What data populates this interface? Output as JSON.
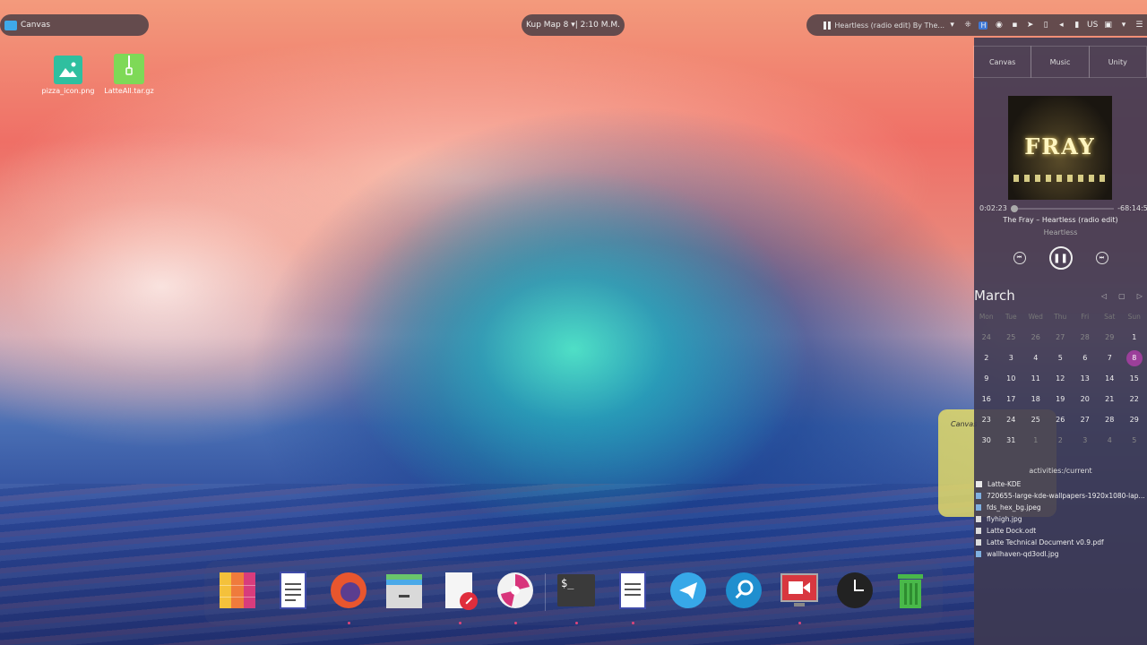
{
  "window_pill": {
    "title": "Canvas"
  },
  "clock": {
    "text": "Kup Map 8 ▾| 2:10 M.M."
  },
  "tray": {
    "media_text": "Heartless (radio edit) By The...",
    "icons": [
      "pause-icon",
      "chevron-down-icon",
      "network-icon",
      "app-icon",
      "record-icon",
      "video-icon",
      "send-icon",
      "clipboard-icon",
      "volume-icon",
      "battery-icon",
      "keyboard-layout",
      "display-icon",
      "chevron-down-icon",
      "menu-icon"
    ],
    "keyboard_layout": "US"
  },
  "desktop_icons": [
    {
      "label": "pizza_icon.png",
      "color": "#2fbf9f"
    },
    {
      "label": "LatteAll.tar.gz",
      "color": "#7ed957"
    }
  ],
  "panel": {
    "tabs": [
      "Canvas",
      "Music",
      "Unity"
    ],
    "media": {
      "band_art": "FRAY",
      "elapsed": "0:02:23",
      "remaining": "-68:14:51",
      "progress": 0.001,
      "track": "The Fray – Heartless (radio edit)",
      "album": "Heartless"
    },
    "calendar": {
      "month": "March",
      "weekdays": [
        "Mon",
        "Tue",
        "Wed",
        "Thu",
        "Fri",
        "Sat",
        "Sun"
      ],
      "days": [
        {
          "d": "24",
          "dim": true
        },
        {
          "d": "25",
          "dim": true
        },
        {
          "d": "26",
          "dim": true
        },
        {
          "d": "27",
          "dim": true
        },
        {
          "d": "28",
          "dim": true
        },
        {
          "d": "29",
          "dim": true
        },
        {
          "d": "1"
        },
        {
          "d": "2"
        },
        {
          "d": "3"
        },
        {
          "d": "4"
        },
        {
          "d": "5"
        },
        {
          "d": "6"
        },
        {
          "d": "7"
        },
        {
          "d": "8",
          "today": true
        },
        {
          "d": "9"
        },
        {
          "d": "10"
        },
        {
          "d": "11"
        },
        {
          "d": "12"
        },
        {
          "d": "13"
        },
        {
          "d": "14"
        },
        {
          "d": "15"
        },
        {
          "d": "16"
        },
        {
          "d": "17"
        },
        {
          "d": "18"
        },
        {
          "d": "19"
        },
        {
          "d": "20"
        },
        {
          "d": "21"
        },
        {
          "d": "22"
        },
        {
          "d": "23"
        },
        {
          "d": "24"
        },
        {
          "d": "25"
        },
        {
          "d": "26"
        },
        {
          "d": "27"
        },
        {
          "d": "28"
        },
        {
          "d": "29"
        },
        {
          "d": "30"
        },
        {
          "d": "31"
        },
        {
          "d": "1",
          "dim": true
        },
        {
          "d": "2",
          "dim": true
        },
        {
          "d": "3",
          "dim": true
        },
        {
          "d": "4",
          "dim": true
        },
        {
          "d": "5",
          "dim": true
        }
      ]
    },
    "folder": {
      "title": "activities:/current",
      "files": [
        "Latte-KDE",
        "720655-large-kde-wallpapers-1920x1080-lap...",
        "fds_hex_bg.jpeg",
        "flyhigh.jpg",
        "Latte Dock.odt",
        "Latte Technical Document v0.9.pdf",
        "wallhaven-qd3odl.jpg"
      ]
    }
  },
  "note": {
    "title": "Canvas"
  },
  "dock": {
    "items": [
      {
        "name": "color-palette-app",
        "color": "#f0a030",
        "dot": false
      },
      {
        "name": "text-document",
        "color": "#ffffff",
        "dot": false
      },
      {
        "name": "firefox",
        "color": "#e8562e",
        "dot": true
      },
      {
        "name": "file-manager",
        "color": "#d9d9d9",
        "dot": false
      },
      {
        "name": "document-editor",
        "color": "#ffffff",
        "dot": true
      },
      {
        "name": "audio-player",
        "color": "#f2f2f2",
        "dot": true
      },
      {
        "name": "terminal",
        "color": "#3a3a3a",
        "dot": true
      },
      {
        "name": "writer-document",
        "color": "#ffffff",
        "dot": true
      },
      {
        "name": "telegram",
        "color": "#37a8e8",
        "dot": false
      },
      {
        "name": "search",
        "color": "#1f8fcf",
        "dot": false
      },
      {
        "name": "screen-recorder",
        "color": "#d8373f",
        "dot": true
      },
      {
        "name": "clock",
        "color": "#222222",
        "dot": false
      },
      {
        "name": "trash",
        "color": "#49b84a",
        "dot": false
      }
    ]
  }
}
